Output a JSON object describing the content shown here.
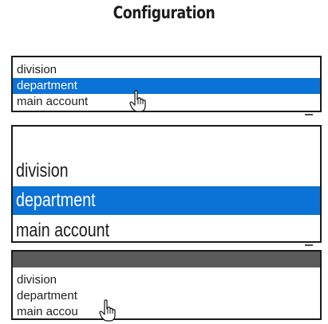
{
  "title": "Configuration",
  "lists": [
    {
      "items": [
        "division",
        "department",
        "main account"
      ],
      "selected": "department"
    },
    {
      "items": [
        "division",
        "department",
        "main account"
      ],
      "selected": "department"
    },
    {
      "items": [
        "division",
        "department",
        "main accou"
      ],
      "selected": null
    }
  ],
  "icons": {
    "pointer": "hand-pointer-icon"
  },
  "colors": {
    "selection": "#0b72d6",
    "header_bar": "#5a5a5a"
  }
}
